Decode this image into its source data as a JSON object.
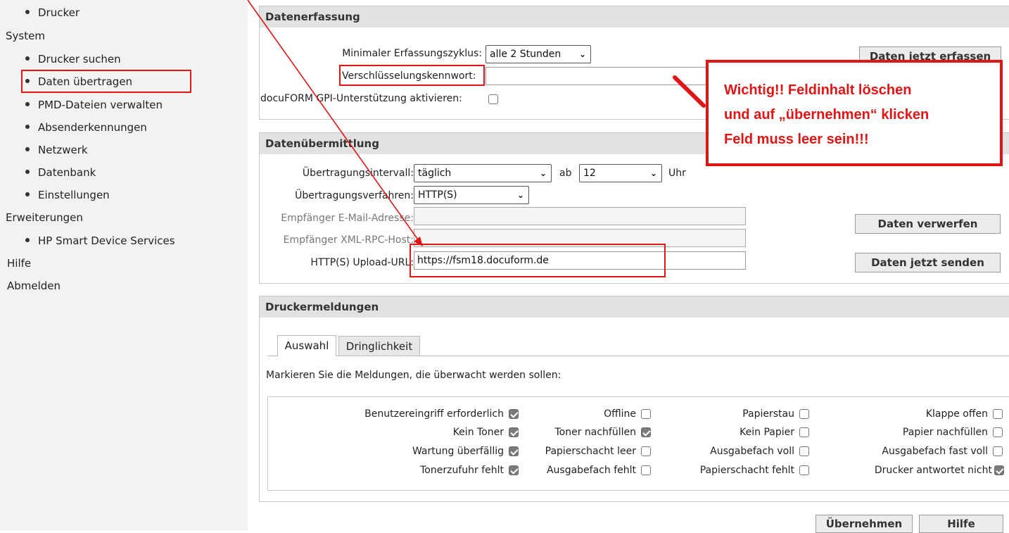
{
  "sidebar": {
    "items": [
      {
        "type": "item",
        "label": "Drucker"
      },
      {
        "type": "section",
        "label": "System"
      },
      {
        "type": "item",
        "label": "Drucker suchen"
      },
      {
        "type": "item",
        "label": "Daten übertragen"
      },
      {
        "type": "item",
        "label": "PMD-Dateien verwalten"
      },
      {
        "type": "item",
        "label": "Absenderkennungen"
      },
      {
        "type": "item",
        "label": "Netzwerk"
      },
      {
        "type": "item",
        "label": "Datenbank"
      },
      {
        "type": "item",
        "label": "Einstellungen"
      },
      {
        "type": "section",
        "label": "Erweiterungen"
      },
      {
        "type": "item",
        "label": "HP Smart Device Services"
      },
      {
        "type": "section",
        "label": "Hilfe"
      },
      {
        "type": "section",
        "label": "Abmelden"
      }
    ]
  },
  "datenerfassung": {
    "title": "Datenerfassung",
    "zyklus_label": "Minimaler Erfassungszyklus:",
    "zyklus_value": "alle 2 Stunden",
    "kennwort_label": "Verschlüsselungskennwort:",
    "kennwort_value": "",
    "gpi_label": "docuFORM GPI-Unterstützung aktivieren:",
    "gpi_checked": false,
    "erfassen_button": "Daten jetzt erfassen"
  },
  "annotation": {
    "line1": "Wichtig!! Feldinhalt löschen",
    "line2": "und auf „übernehmen“ klicken",
    "line3": "Feld muss leer sein!!!",
    "color": "#e01515"
  },
  "datenuebermittlung": {
    "title": "Datenübermittlung",
    "intervall_label": "Übertragungsintervall:",
    "intervall_value": "täglich",
    "ab_label": "ab",
    "ab_value": "12",
    "uhr_label": "Uhr",
    "verfahren_label": "Übertragungsverfahren:",
    "verfahren_value": "HTTP(S)",
    "email_label": "Empfänger E-Mail-Adresse:",
    "email_value": "",
    "xmlrpc_label": "Empfänger XML-RPC-Host:",
    "xmlrpc_value": "",
    "upload_label": "HTTP(S) Upload-URL:",
    "upload_value": "https://fsm18.docuform.de",
    "verwerfen_button": "Daten verwerfen",
    "senden_button": "Daten jetzt senden"
  },
  "druckermeldungen": {
    "title": "Druckermeldungen",
    "tabs": [
      "Auswahl",
      "Dringlichkeit"
    ],
    "instruction": "Markieren Sie die Meldungen, die überwacht werden sollen:",
    "messages": [
      {
        "label": "Benutzereingriff erforderlich",
        "checked": true
      },
      {
        "label": "Offline",
        "checked": false
      },
      {
        "label": "Papierstau",
        "checked": false
      },
      {
        "label": "Klappe offen",
        "checked": false
      },
      {
        "label": "Kein Toner",
        "checked": true
      },
      {
        "label": "Toner nachfüllen",
        "checked": true
      },
      {
        "label": "Kein Papier",
        "checked": false
      },
      {
        "label": "Papier nachfüllen",
        "checked": false
      },
      {
        "label": "Wartung überfällig",
        "checked": true
      },
      {
        "label": "Papierschacht leer",
        "checked": false
      },
      {
        "label": "Ausgabefach voll",
        "checked": false
      },
      {
        "label": "Ausgabefach fast voll",
        "checked": false
      },
      {
        "label": "Tonerzufuhr fehlt",
        "checked": true
      },
      {
        "label": "Ausgabefach fehlt",
        "checked": false
      },
      {
        "label": "Papierschacht fehlt",
        "checked": false
      },
      {
        "label": "Drucker antwortet nicht",
        "checked": true
      }
    ]
  },
  "footer": {
    "uebernehmen_button": "Übernehmen",
    "hilfe_button": "Hilfe"
  }
}
